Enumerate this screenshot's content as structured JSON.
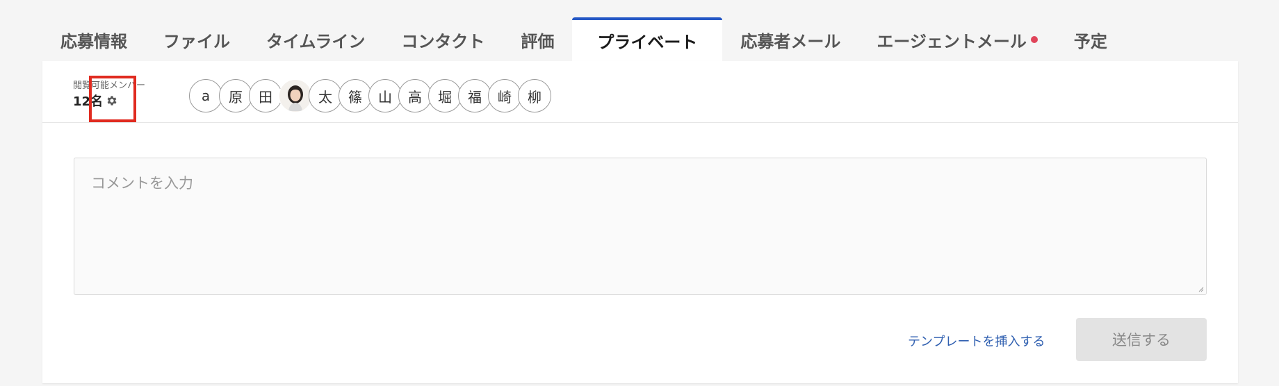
{
  "tabs": [
    {
      "label": "応募情報"
    },
    {
      "label": "ファイル"
    },
    {
      "label": "タイムライン"
    },
    {
      "label": "コンタクト"
    },
    {
      "label": "評価"
    },
    {
      "label": "プライベート",
      "active": true
    },
    {
      "label": "応募者メール"
    },
    {
      "label": "エージェントメール",
      "has_notification": true
    },
    {
      "label": "予定"
    }
  ],
  "members": {
    "label": "閲覧可能メンバー",
    "count": "12名",
    "avatars": [
      {
        "initial": "a"
      },
      {
        "initial": "原"
      },
      {
        "initial": "田"
      },
      {
        "initial": "",
        "photo": true
      },
      {
        "initial": "太"
      },
      {
        "initial": "篠"
      },
      {
        "initial": "山"
      },
      {
        "initial": "高"
      },
      {
        "initial": "堀"
      },
      {
        "initial": "福"
      },
      {
        "initial": "崎"
      },
      {
        "initial": "柳"
      }
    ]
  },
  "comment": {
    "placeholder": "コメントを入力"
  },
  "actions": {
    "template_link": "テンプレートを挿入する",
    "send_label": "送信する"
  },
  "colors": {
    "active_tab_border": "#2457c5",
    "notification_dot": "#e0445a",
    "link": "#2f5fb0",
    "highlight": "#e02b20"
  }
}
